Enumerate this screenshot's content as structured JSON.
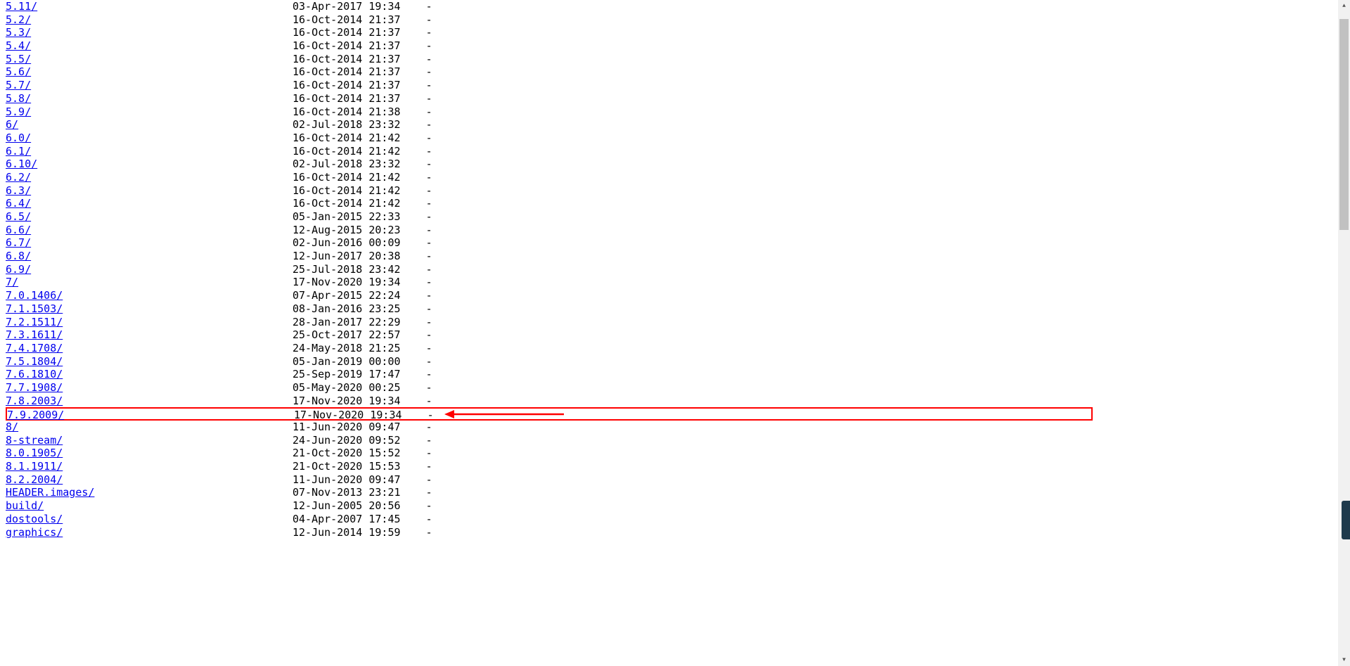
{
  "listing": [
    {
      "name": "5.11/",
      "date": "03-Apr-2017 19:34",
      "size": "-"
    },
    {
      "name": "5.2/",
      "date": "16-Oct-2014 21:37",
      "size": "-"
    },
    {
      "name": "5.3/",
      "date": "16-Oct-2014 21:37",
      "size": "-"
    },
    {
      "name": "5.4/",
      "date": "16-Oct-2014 21:37",
      "size": "-"
    },
    {
      "name": "5.5/",
      "date": "16-Oct-2014 21:37",
      "size": "-"
    },
    {
      "name": "5.6/",
      "date": "16-Oct-2014 21:37",
      "size": "-"
    },
    {
      "name": "5.7/",
      "date": "16-Oct-2014 21:37",
      "size": "-"
    },
    {
      "name": "5.8/",
      "date": "16-Oct-2014 21:37",
      "size": "-"
    },
    {
      "name": "5.9/",
      "date": "16-Oct-2014 21:38",
      "size": "-"
    },
    {
      "name": "6/",
      "date": "02-Jul-2018 23:32",
      "size": "-"
    },
    {
      "name": "6.0/",
      "date": "16-Oct-2014 21:42",
      "size": "-"
    },
    {
      "name": "6.1/",
      "date": "16-Oct-2014 21:42",
      "size": "-"
    },
    {
      "name": "6.10/",
      "date": "02-Jul-2018 23:32",
      "size": "-"
    },
    {
      "name": "6.2/",
      "date": "16-Oct-2014 21:42",
      "size": "-"
    },
    {
      "name": "6.3/",
      "date": "16-Oct-2014 21:42",
      "size": "-"
    },
    {
      "name": "6.4/",
      "date": "16-Oct-2014 21:42",
      "size": "-"
    },
    {
      "name": "6.5/",
      "date": "05-Jan-2015 22:33",
      "size": "-"
    },
    {
      "name": "6.6/",
      "date": "12-Aug-2015 20:23",
      "size": "-"
    },
    {
      "name": "6.7/",
      "date": "02-Jun-2016 00:09",
      "size": "-"
    },
    {
      "name": "6.8/",
      "date": "12-Jun-2017 20:38",
      "size": "-"
    },
    {
      "name": "6.9/",
      "date": "25-Jul-2018 23:42",
      "size": "-"
    },
    {
      "name": "7/",
      "date": "17-Nov-2020 19:34",
      "size": "-"
    },
    {
      "name": "7.0.1406/",
      "date": "07-Apr-2015 22:24",
      "size": "-"
    },
    {
      "name": "7.1.1503/",
      "date": "08-Jan-2016 23:25",
      "size": "-"
    },
    {
      "name": "7.2.1511/",
      "date": "28-Jan-2017 22:29",
      "size": "-"
    },
    {
      "name": "7.3.1611/",
      "date": "25-Oct-2017 22:57",
      "size": "-"
    },
    {
      "name": "7.4.1708/",
      "date": "24-May-2018 21:25",
      "size": "-"
    },
    {
      "name": "7.5.1804/",
      "date": "05-Jan-2019 00:00",
      "size": "-"
    },
    {
      "name": "7.6.1810/",
      "date": "25-Sep-2019 17:47",
      "size": "-"
    },
    {
      "name": "7.7.1908/",
      "date": "05-May-2020 00:25",
      "size": "-"
    },
    {
      "name": "7.8.2003/",
      "date": "17-Nov-2020 19:34",
      "size": "-"
    },
    {
      "name": "7.9.2009/",
      "date": "17-Nov-2020 19:34",
      "size": "-",
      "highlight": true
    },
    {
      "name": "8/",
      "date": "11-Jun-2020 09:47",
      "size": "-"
    },
    {
      "name": "8-stream/",
      "date": "24-Jun-2020 09:52",
      "size": "-"
    },
    {
      "name": "8.0.1905/",
      "date": "21-Oct-2020 15:52",
      "size": "-"
    },
    {
      "name": "8.1.1911/",
      "date": "21-Oct-2020 15:53",
      "size": "-"
    },
    {
      "name": "8.2.2004/",
      "date": "11-Jun-2020 09:47",
      "size": "-"
    },
    {
      "name": "HEADER.images/",
      "date": "07-Nov-2013 23:21",
      "size": "-"
    },
    {
      "name": "build/",
      "date": "12-Jun-2005 20:56",
      "size": "-"
    },
    {
      "name": "dostools/",
      "date": "04-Apr-2007 17:45",
      "size": "-"
    },
    {
      "name": "graphics/",
      "date": "12-Jun-2014 19:59",
      "size": "-"
    }
  ],
  "meta_col": 45,
  "size_col": 66,
  "annotation": {
    "highlight_color": "#ff0000"
  }
}
